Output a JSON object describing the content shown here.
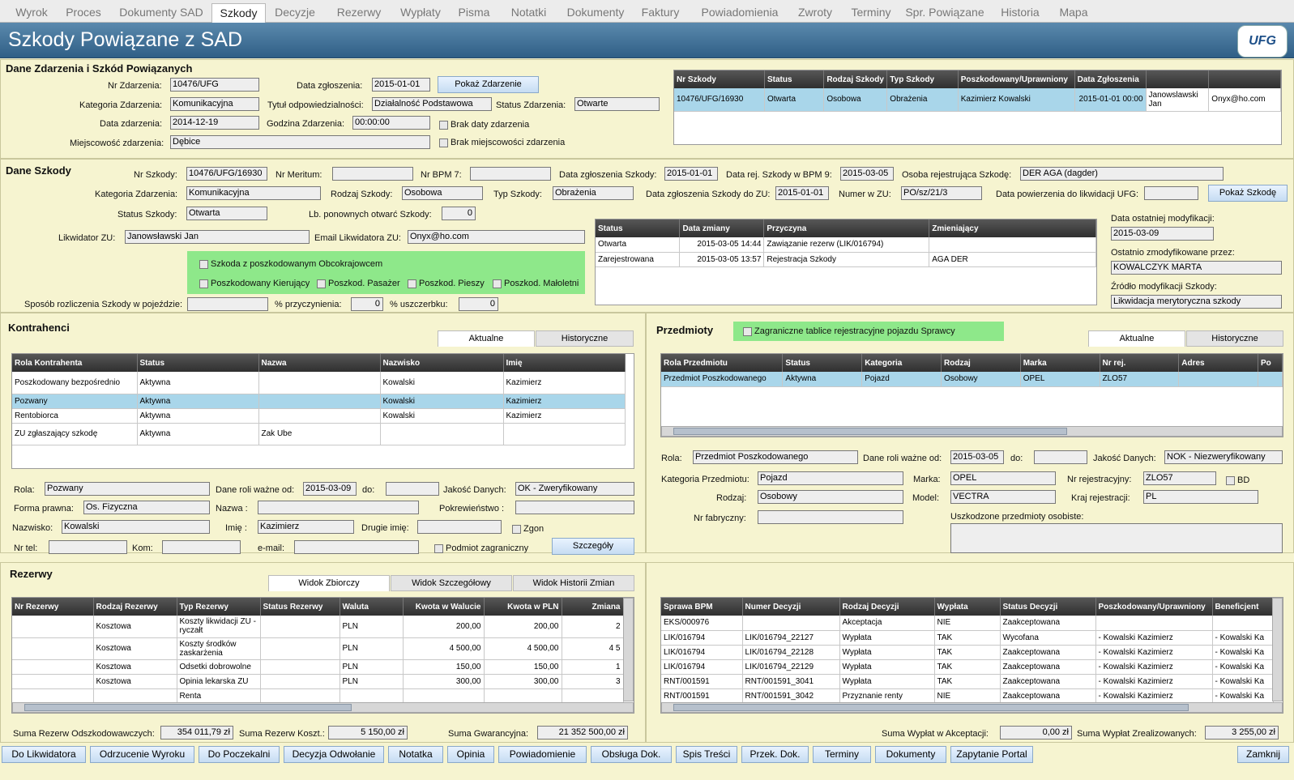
{
  "tabs": [
    "Wyrok",
    "Proces",
    "Dokumenty SAD",
    "Szkody",
    "Decyzje",
    "Rezerwy",
    "Wypłaty",
    "Pisma",
    "Notatki",
    "Dokumenty",
    "Faktury",
    "Powiadomienia",
    "Zwroty",
    "Terminy",
    "Spr. Powiązane",
    "Historia",
    "Mapa"
  ],
  "title": "Szkody Powiązane z SAD",
  "logo": "UFG",
  "zdarzenie": {
    "heading": "Dane Zdarzenia i Szkód Powiązanych",
    "nr_label": "Nr Zdarzenia:",
    "nr": "10476/UFG",
    "data_zgl_label": "Data zgłoszenia:",
    "data_zgl": "2015-01-01",
    "pokaz": "Pokaż Zdarzenie",
    "kat_label": "Kategoria Zdarzenia:",
    "kat": "Komunikacyjna",
    "tytul_label": "Tytuł odpowiedzialności:",
    "tytul": "Działalność Podstawowa",
    "status_label": "Status Zdarzenia:",
    "status": "Otwarte",
    "data_zd_label": "Data zdarzenia:",
    "data_zd": "2014-12-19",
    "godz_label": "Godzina Zdarzenia:",
    "godz": "00:00:00",
    "brak_daty": "Brak daty zdarzenia",
    "miejsc_label": "Miejscowość zdarzenia:",
    "miejsc": "Dębice",
    "brak_miejsc": "Brak miejscowości zdarzenia"
  },
  "szkody_grid": {
    "headers": [
      "Nr Szkody",
      "Status",
      "Rodzaj Szkody",
      "Typ Szkody",
      "Poszkodowany/Uprawniony",
      "Data Zgłoszenia",
      "",
      ""
    ],
    "row": [
      "10476/UFG/16930",
      "Otwarta",
      "Osobowa",
      "Obrażenia",
      "Kazimierz Kowalski",
      "2015-01-01 00:00",
      "Janowslawski Jan",
      "Onyx@ho.com"
    ]
  },
  "szkoda": {
    "heading": "Dane Szkody",
    "nr_label": "Nr Szkody:",
    "nr": "10476/UFG/16930",
    "meritum_label": "Nr Meritum:",
    "bpm7_label": "Nr BPM 7:",
    "dzs_label": "Data zgłoszenia Szkody:",
    "dzs": "2015-01-01",
    "drs_label": "Data rej. Szkody w BPM 9:",
    "drs": "2015-03-05",
    "osoba_label": "Osoba rejestrująca Szkodę:",
    "osoba": "DER AGA (dagder)",
    "kat_label": "Kategoria Zdarzenia:",
    "kat": "Komunikacyjna",
    "rodzaj_label": "Rodzaj Szkody:",
    "rodzaj": "Osobowa",
    "typ_label": "Typ Szkody:",
    "typ": "Obrażenia",
    "dzszu_label": "Data zgłoszenia Szkody do ZU:",
    "dzszu": "2015-01-01",
    "nrzu_label": "Numer w ZU:",
    "nrzu": "PO/sz/21/3",
    "dpow_label": "Data powierzenia do likwidacji UFG:",
    "pokaz": "Pokaż Szkodę",
    "status_label": "Status Szkody:",
    "status": "Otwarta",
    "lbpon_label": "Lb. ponownych otwarć Szkody:",
    "lbpon": "0",
    "lik_label": "Likwidator ZU:",
    "lik": "Janowsławski Jan",
    "email_label": "Email Likwidatora ZU:",
    "email": "Onyx@ho.com",
    "obco": "Szkoda z poszkodowanym Obcokrajowcem",
    "kier": "Poszkodowany Kierujący",
    "pas": "Poszkod. Pasażer",
    "pie": "Poszkod. Pieszy",
    "mal": "Poszkod. Małoletni",
    "sposob_label": "Sposób rozliczenia Szkody w pojeździe:",
    "przycz_label": "% przyczynienia:",
    "przycz": "0",
    "uszcz_label": "% uszczerbku:",
    "uszcz": "0",
    "dom_label": "Data ostatniej modyfikacji:",
    "dom": "2015-03-09",
    "ozp_label": "Ostatnio zmodyfikowane przez:",
    "ozp": "KOWALCZYK MARTA",
    "zrodlo_label": "Źródło modyfikacji Szkody:",
    "zrodlo": "Likwidacja merytoryczna szkody"
  },
  "status_grid": {
    "headers": [
      "Status",
      "Data zmiany",
      "Przyczyna",
      "Zmieniający"
    ],
    "rows": [
      [
        "Otwarta",
        "2015-03-05 14:44",
        "Zawiązanie rezerw (LIK/016794)",
        ""
      ],
      [
        "Zarejestrowana",
        "2015-03-05 13:57",
        "Rejestracja Szkody",
        "AGA DER"
      ]
    ]
  },
  "kontrahenci": {
    "heading": "Kontrahenci",
    "tab1": "Aktualne",
    "tab2": "Historyczne",
    "headers": [
      "Rola Kontrahenta",
      "Status",
      "Nazwa",
      "Nazwisko",
      "Imię"
    ],
    "rows": [
      [
        "Poszkodowany bezpośrednio",
        "Aktywna",
        "",
        "Kowalski",
        "Kazimierz"
      ],
      [
        "Pozwany",
        "Aktywna",
        "",
        "Kowalski",
        "Kazimierz"
      ],
      [
        "Rentobiorca",
        "Aktywna",
        "",
        "Kowalski",
        "Kazimierz"
      ],
      [
        "ZU zgłaszający szkodę",
        "Aktywna",
        "Zak Ube",
        "",
        ""
      ]
    ],
    "rola_label": "Rola:",
    "rola": "Pozwany",
    "dro_label": "Dane roli ważne od:",
    "dro": "2015-03-09",
    "do_label": "do:",
    "jak_label": "Jakość Danych:",
    "jak": "OK - Zweryfikowany",
    "fp_label": "Forma prawna:",
    "fp": "Os. Fizyczna",
    "nazwa_label": "Nazwa :",
    "pok_label": "Pokrewieństwo :",
    "nazw_label": "Nazwisko:",
    "nazw": "Kowalski",
    "imie_label": "Imię :",
    "imie": "Kazimierz",
    "dimie_label": "Drugie imię:",
    "zgon": "Zgon",
    "tel_label": "Nr tel:",
    "kom_label": "Kom:",
    "email_label": "e-mail:",
    "zagr": "Podmiot zagraniczny",
    "szcz": "Szczegóły"
  },
  "przedmioty": {
    "heading": "Przedmioty",
    "zagr": "Zagraniczne tablice rejestracyjne pojazdu Sprawcy",
    "tab1": "Aktualne",
    "tab2": "Historyczne",
    "headers": [
      "Rola Przedmiotu",
      "Status",
      "Kategoria",
      "Rodzaj",
      "Marka",
      "Nr rej.",
      "Adres",
      "Po"
    ],
    "row": [
      "Przedmiot Poszkodowanego",
      "Aktywna",
      "Pojazd",
      "Osobowy",
      "OPEL",
      "ZLO57",
      "",
      ""
    ],
    "rola_label": "Rola:",
    "rola": "Przedmiot Poszkodowanego",
    "dro_label": "Dane roli ważne od:",
    "dro": "2015-03-05",
    "do_label": "do:",
    "jak_label": "Jakość Danych:",
    "jak": "NOK - Niezweryfikowany",
    "kat_label": "Kategoria Przedmiotu:",
    "kat": "Pojazd",
    "marka_label": "Marka:",
    "marka": "OPEL",
    "nrrej_label": "Nr rejestracyjny:",
    "nrrej": "ZLO57",
    "bd": "BD",
    "rodz_label": "Rodzaj:",
    "rodz": "Osobowy",
    "model_label": "Model:",
    "model": "VECTRA",
    "kraj_label": "Kraj rejestracji:",
    "kraj": "PL",
    "nrfab_label": "Nr fabryczny:",
    "uszk_label": "Uszkodzone przedmioty osobiste:"
  },
  "rezerwy": {
    "heading": "Rezerwy",
    "tab1": "Widok Zbiorczy",
    "tab2": "Widok Szczegółowy",
    "tab3": "Widok Historii Zmian",
    "headers": [
      "Nr Rezerwy",
      "Rodzaj Rezerwy",
      "Typ Rezerwy",
      "Status Rezerwy",
      "Waluta",
      "Kwota w Walucie",
      "Kwota w PLN",
      "Zmiana"
    ],
    "rows": [
      [
        "",
        "Kosztowa",
        "Koszty likwidacji ZU - ryczałt",
        "",
        "PLN",
        "200,00",
        "200,00",
        "2"
      ],
      [
        "",
        "Kosztowa",
        "Koszty środków zaskarżenia",
        "",
        "PLN",
        "4 500,00",
        "4 500,00",
        "4 5"
      ],
      [
        "",
        "Kosztowa",
        "Odsetki dobrowolne",
        "",
        "PLN",
        "150,00",
        "150,00",
        "1"
      ],
      [
        "",
        "Kosztowa",
        "Opinia lekarska ZU",
        "",
        "PLN",
        "300,00",
        "300,00",
        "3"
      ],
      [
        "",
        "",
        "Renta",
        "",
        "",
        "",
        "",
        ""
      ]
    ],
    "sro_label": "Suma Rezerw Odszkodowawczych:",
    "sro": "354 011,79 zł",
    "srk_label": "Suma Rezerw Koszt.:",
    "srk": "5 150,00 zł",
    "sg_label": "Suma Gwarancyjna:",
    "sg": "21 352 500,00 zł"
  },
  "decyzje": {
    "headers": [
      "Sprawa BPM",
      "Numer Decyzji",
      "Rodzaj Decyzji",
      "Wypłata",
      "Status Decyzji",
      "Poszkodowany/Uprawniony",
      "Beneficjent"
    ],
    "rows": [
      [
        "EKS/000976",
        "",
        "Akceptacja",
        "NIE",
        "Zaakceptowana",
        "",
        ""
      ],
      [
        "LIK/016794",
        "LIK/016794_22127",
        "Wypłata",
        "TAK",
        "Wycofana",
        "- Kowalski Kazimierz",
        "- Kowalski Ka"
      ],
      [
        "LIK/016794",
        "LIK/016794_22128",
        "Wypłata",
        "TAK",
        "Zaakceptowana",
        "- Kowalski Kazimierz",
        "- Kowalski Ka"
      ],
      [
        "LIK/016794",
        "LIK/016794_22129",
        "Wypłata",
        "TAK",
        "Zaakceptowana",
        "- Kowalski Kazimierz",
        "- Kowalski Ka"
      ],
      [
        "RNT/001591",
        "RNT/001591_3041",
        "Wypłata",
        "TAK",
        "Zaakceptowana",
        "- Kowalski Kazimierz",
        "- Kowalski Ka"
      ],
      [
        "RNT/001591",
        "RNT/001591_3042",
        "Przyznanie renty",
        "NIE",
        "Zaakceptowana",
        "- Kowalski Kazimierz",
        "- Kowalski Ka"
      ]
    ],
    "swa_label": "Suma Wypłat w Akceptacji:",
    "swa": "0,00 zł",
    "swz_label": "Suma Wypłat Zrealizowanych:",
    "swz": "3 255,00 zł"
  },
  "bottom": [
    "Do Likwidatora",
    "Odrzucenie Wyroku",
    "Do Poczekalni",
    "Decyzja Odwołanie",
    "Notatka",
    "Opinia",
    "Powiadomienie",
    "Obsługa Dok.",
    "Spis Treści",
    "Przek. Dok.",
    "Terminy",
    "Dokumenty",
    "Zapytanie Portal"
  ],
  "zamknij": "Zamknij"
}
